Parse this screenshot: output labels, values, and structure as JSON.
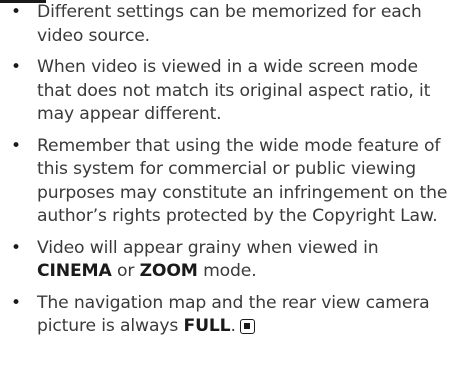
{
  "bullets": [
    {
      "text": "Different settings can be memorized for each video source."
    },
    {
      "text": "When video is viewed in a wide screen mode that does not match its original aspect ratio, it may appear different."
    },
    {
      "text": "Remember that using the wide mode feature of this system for commercial or public viewing purposes may constitute an infringement on the author’s rights protected by the Copyright Law."
    },
    {
      "before": "Video will appear grainy when viewed in ",
      "bold1": "CINEMA",
      "mid": " or ",
      "bold2": "ZOOM",
      "after": " mode."
    },
    {
      "before": "The navigation map and the rear view camera picture is always ",
      "bold1": "FULL",
      "after": "."
    }
  ],
  "bullet_glyph": "•",
  "end_mark_icon": "end-of-section-icon"
}
